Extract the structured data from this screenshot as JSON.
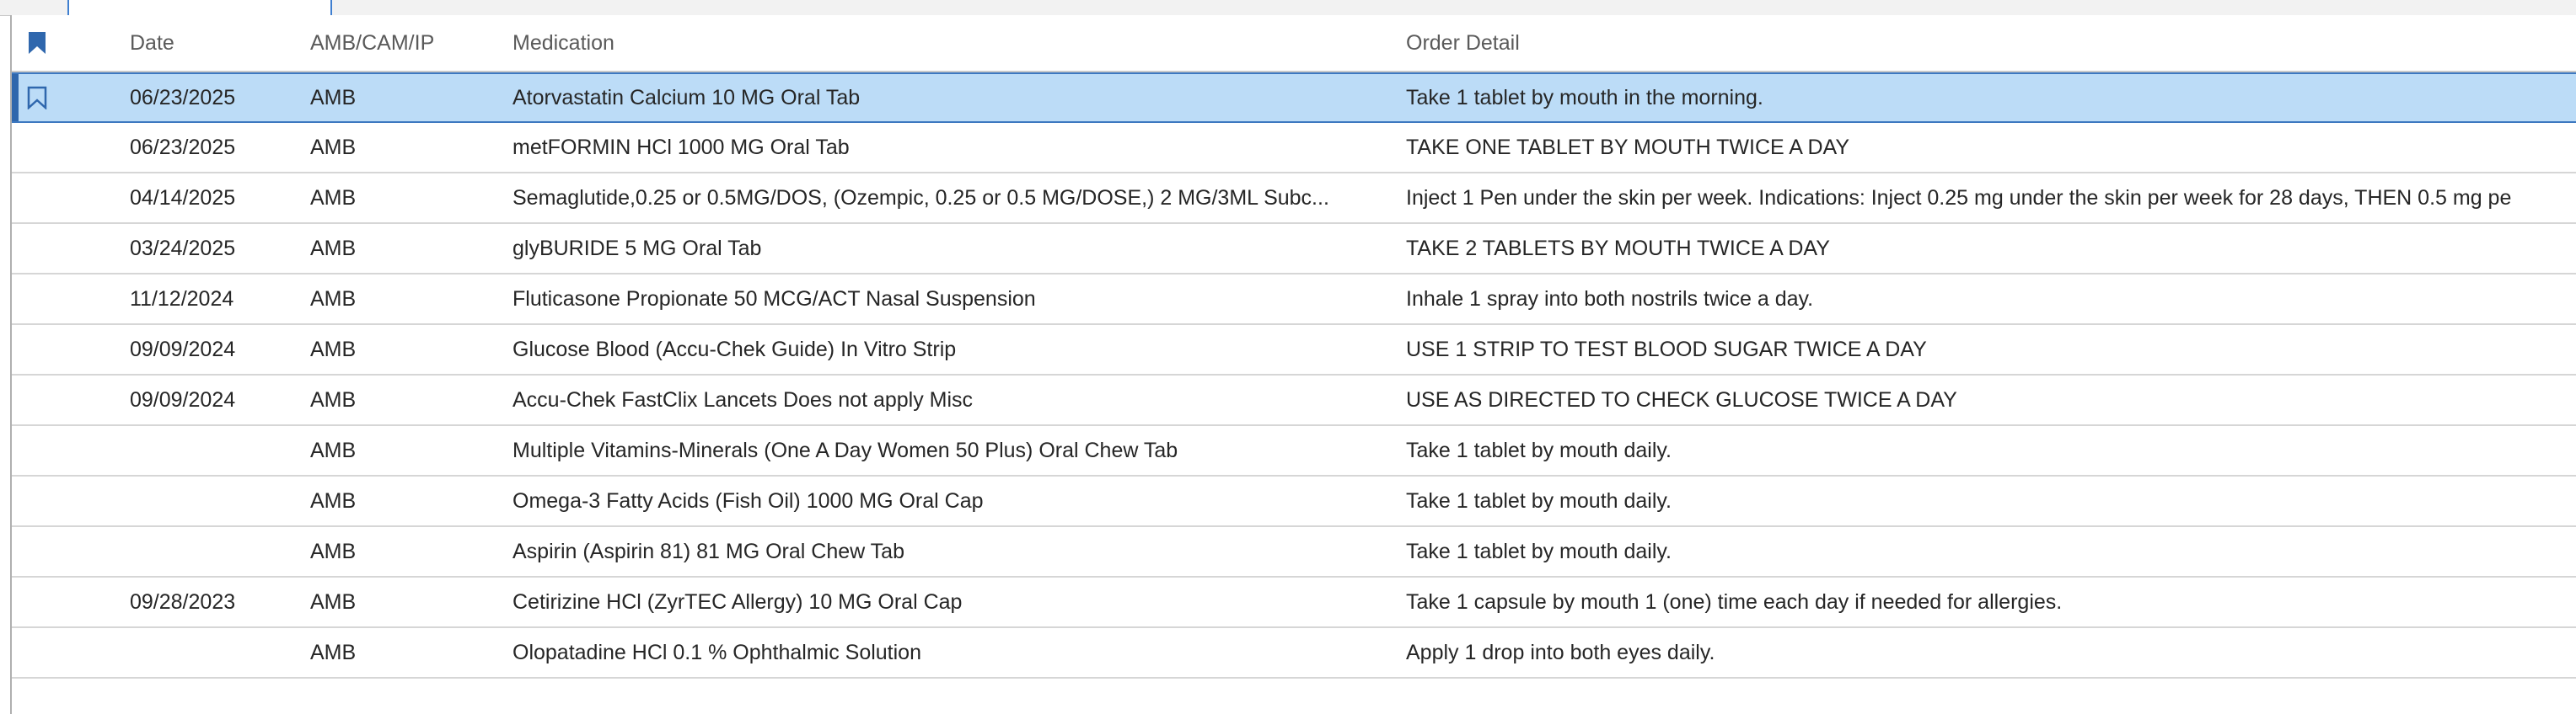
{
  "columns": {
    "date": "Date",
    "amb": "AMB/CAM/IP",
    "medication": "Medication",
    "order_detail": "Order Detail"
  },
  "icons": {
    "header_flag": "bookmark-flag-solid-icon",
    "row_flag": "bookmark-flag-outline-icon"
  },
  "colors": {
    "selection": "#bcdcf7",
    "selection_border": "#3d78c0",
    "flag": "#2f67ad"
  },
  "rows": [
    {
      "date": "06/23/2025",
      "amb": "AMB",
      "medication": "Atorvastatin Calcium 10 MG Oral Tab",
      "order": "Take 1 tablet by mouth in the morning.",
      "selected": true
    },
    {
      "date": "06/23/2025",
      "amb": "AMB",
      "medication": "metFORMIN HCl 1000 MG Oral Tab",
      "order": "TAKE ONE TABLET BY MOUTH TWICE A DAY"
    },
    {
      "date": "04/14/2025",
      "amb": "AMB",
      "medication": "Semaglutide,0.25 or 0.5MG/DOS, (Ozempic, 0.25 or 0.5 MG/DOSE,) 2 MG/3ML Subc...",
      "order": "Inject 1 Pen under the skin per week. Indications: Inject 0.25 mg under the skin per week for 28 days, THEN 0.5 mg pe"
    },
    {
      "date": "03/24/2025",
      "amb": "AMB",
      "medication": "glyBURIDE 5 MG Oral Tab",
      "order": "TAKE 2 TABLETS BY MOUTH TWICE A DAY"
    },
    {
      "date": "11/12/2024",
      "amb": "AMB",
      "medication": "Fluticasone Propionate 50 MCG/ACT Nasal Suspension",
      "order": "Inhale 1 spray into both nostrils twice a day."
    },
    {
      "date": "09/09/2024",
      "amb": "AMB",
      "medication": "Glucose Blood (Accu-Chek Guide) In Vitro Strip",
      "order": "USE 1 STRIP TO TEST BLOOD SUGAR TWICE A DAY"
    },
    {
      "date": "09/09/2024",
      "amb": "AMB",
      "medication": "Accu-Chek FastClix Lancets Does not apply Misc",
      "order": "USE AS DIRECTED TO CHECK GLUCOSE TWICE A DAY"
    },
    {
      "date": "",
      "amb": "AMB",
      "medication": "Multiple Vitamins-Minerals (One A Day Women 50 Plus) Oral Chew Tab",
      "order": "Take 1 tablet by mouth daily."
    },
    {
      "date": "",
      "amb": "AMB",
      "medication": "Omega-3 Fatty Acids (Fish Oil) 1000 MG Oral Cap",
      "order": "Take 1 tablet by mouth daily."
    },
    {
      "date": "",
      "amb": "AMB",
      "medication": "Aspirin (Aspirin 81) 81 MG Oral Chew Tab",
      "order": "Take 1 tablet by mouth daily."
    },
    {
      "date": "09/28/2023",
      "amb": "AMB",
      "medication": "Cetirizine HCl (ZyrTEC Allergy) 10 MG Oral Cap",
      "order": "Take 1 capsule by mouth 1 (one) time each day if needed for allergies."
    },
    {
      "date": "",
      "amb": "AMB",
      "medication": "Olopatadine HCl 0.1 % Ophthalmic Solution",
      "order": "Apply 1 drop into both eyes daily."
    }
  ]
}
